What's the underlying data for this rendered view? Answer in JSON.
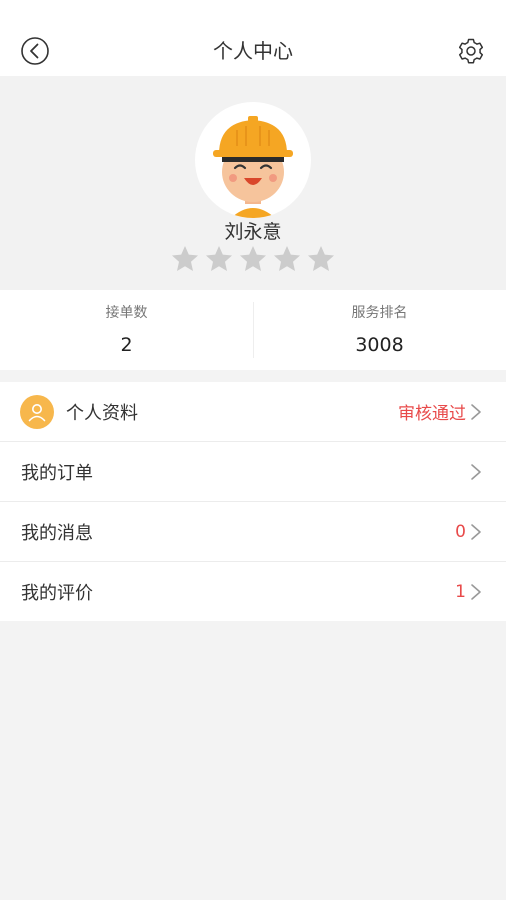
{
  "header": {
    "title": "个人中心",
    "back_icon": "chevron-left-circle-icon",
    "settings_icon": "gear-icon"
  },
  "profile": {
    "name": "刘永意",
    "avatar": "worker-avatar-with-yellow-helmet",
    "rating": 0,
    "rating_max": 5,
    "star_color": "#cccccc"
  },
  "stats": {
    "orders_label": "接单数",
    "orders_value": "2",
    "rank_label": "服务排名",
    "rank_value": "3008"
  },
  "menu": {
    "items": [
      {
        "label": "个人资料",
        "status": "审核通过",
        "icon": "user-icon"
      },
      {
        "label": "我的订单",
        "status": ""
      },
      {
        "label": "我的消息",
        "status": "0"
      },
      {
        "label": "我的评价",
        "status": "1"
      }
    ]
  },
  "colors": {
    "accent_red": "#e84a4a",
    "accent_orange": "#f7b74c",
    "helmet_yellow": "#f5a623"
  }
}
